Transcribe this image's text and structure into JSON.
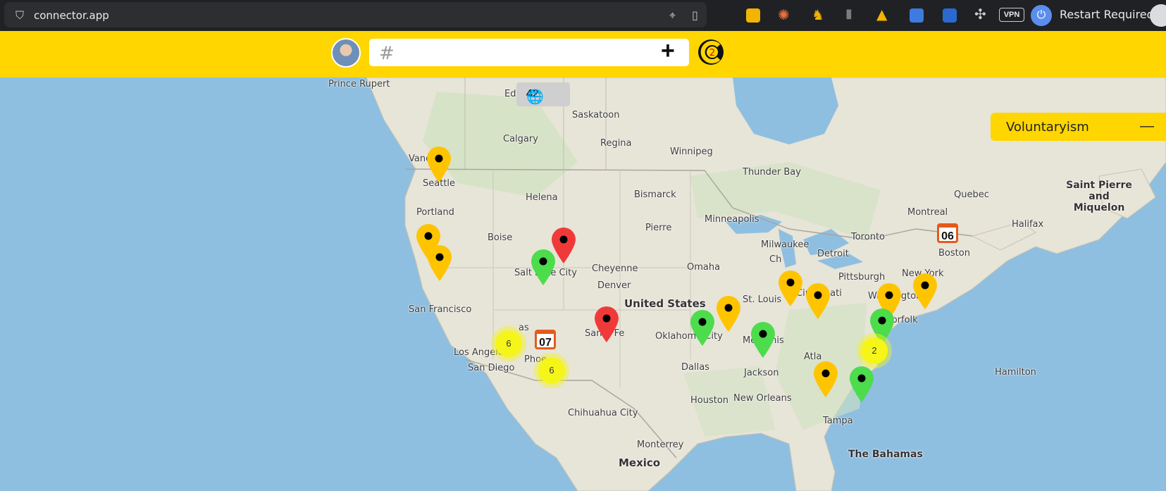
{
  "browser": {
    "url": "connector.app",
    "restart_label": "Restart Required",
    "vpn_label": "VPN"
  },
  "app": {
    "search_placeholder": "",
    "hash_symbol": "#",
    "plus_symbol": "+",
    "logo_badge": "2"
  },
  "map": {
    "count": "42",
    "topic": "Voluntaryism",
    "clusters": [
      {
        "label": "6"
      },
      {
        "label": "6"
      },
      {
        "label": "2"
      }
    ],
    "calendars": [
      {
        "label": "07"
      },
      {
        "label": "06"
      }
    ],
    "cities": [
      "Prince Rupert",
      "Edm",
      "Saskatoon",
      "Calgary",
      "Regina",
      "Winnipeg",
      "Thunder Bay",
      "Vanc",
      "Seattle",
      "Helena",
      "Bismarck",
      "Quebec",
      "Montreal",
      "Portland",
      "Boise",
      "Pierre",
      "Minneapolis",
      "Toronto",
      "Halifax",
      "Milwaukee",
      "Ch",
      "Detroit",
      "Boston",
      "Salt Lake City",
      "Cheyenne",
      "Omaha",
      "Pittsburgh",
      "New York",
      "Denver",
      "Cincinnati",
      "St. Louis",
      "San Francisco",
      "United States",
      "Oklahoma City",
      "Washington",
      "Norfolk",
      "Memphis",
      "Santa Fe",
      "Los Angeles",
      "Phoe",
      "Atla",
      "San Diego",
      "Dallas",
      "Jackson",
      "Hamilton",
      "Houston",
      "New Orleans",
      "Chihuahua City",
      "Tampa",
      "The Bahamas",
      "Monterrey",
      "Mexico",
      "Saint Pierre and Miquelon",
      "as"
    ]
  },
  "colors": {
    "brand_yellow": "#ffd600",
    "pin_yellow": "#ffc400",
    "pin_green": "#4cdc4c",
    "pin_red": "#f03a3a",
    "land": "#e7e4d8",
    "water": "#8fbfe0"
  }
}
